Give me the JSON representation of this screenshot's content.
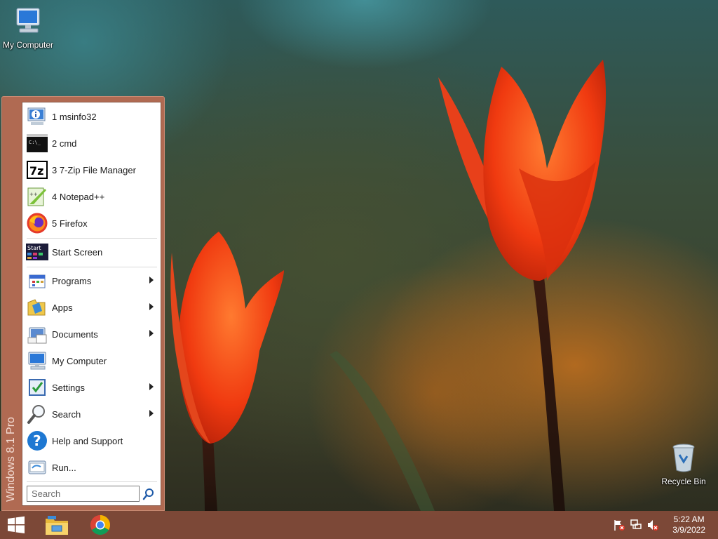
{
  "desktop": {
    "icons": [
      {
        "label": "My Computer"
      },
      {
        "label": "Recycle Bin"
      }
    ]
  },
  "start_menu": {
    "side_label": "Windows 8.1 Pro",
    "recent": [
      {
        "label": "1 msinfo32",
        "icon": "info-icon"
      },
      {
        "label": "2 cmd",
        "icon": "cmd-icon"
      },
      {
        "label": "3 7-Zip File Manager",
        "icon": "7zip-icon"
      },
      {
        "label": "4 Notepad++",
        "icon": "notepad-plus-icon"
      },
      {
        "label": "5 Firefox",
        "icon": "firefox-icon"
      }
    ],
    "start_screen": {
      "label": "Start Screen",
      "icon_text": "Start"
    },
    "items": [
      {
        "label": "Programs",
        "icon": "programs-icon",
        "submenu": true
      },
      {
        "label": "Apps",
        "icon": "apps-icon",
        "submenu": true
      },
      {
        "label": "Documents",
        "icon": "documents-icon",
        "submenu": true
      },
      {
        "label": "My Computer",
        "icon": "computer-icon",
        "submenu": false
      },
      {
        "label": "Settings",
        "icon": "settings-icon",
        "submenu": true
      },
      {
        "label": "Search",
        "icon": "search-icon",
        "submenu": true
      },
      {
        "label": "Help and Support",
        "icon": "help-icon",
        "submenu": false
      },
      {
        "label": "Run...",
        "icon": "run-icon",
        "submenu": false
      }
    ],
    "search": {
      "placeholder": "Search"
    }
  },
  "taskbar": {
    "clock": {
      "time": "5:22 AM",
      "date": "3/9/2022"
    },
    "pinned": [
      "file-explorer-icon",
      "chrome-icon"
    ],
    "tray": [
      "action-center-flag-icon",
      "network-icon",
      "volume-muted-icon"
    ]
  },
  "colors": {
    "menu_frame": "#b06a52",
    "taskbar": "#804a38"
  }
}
